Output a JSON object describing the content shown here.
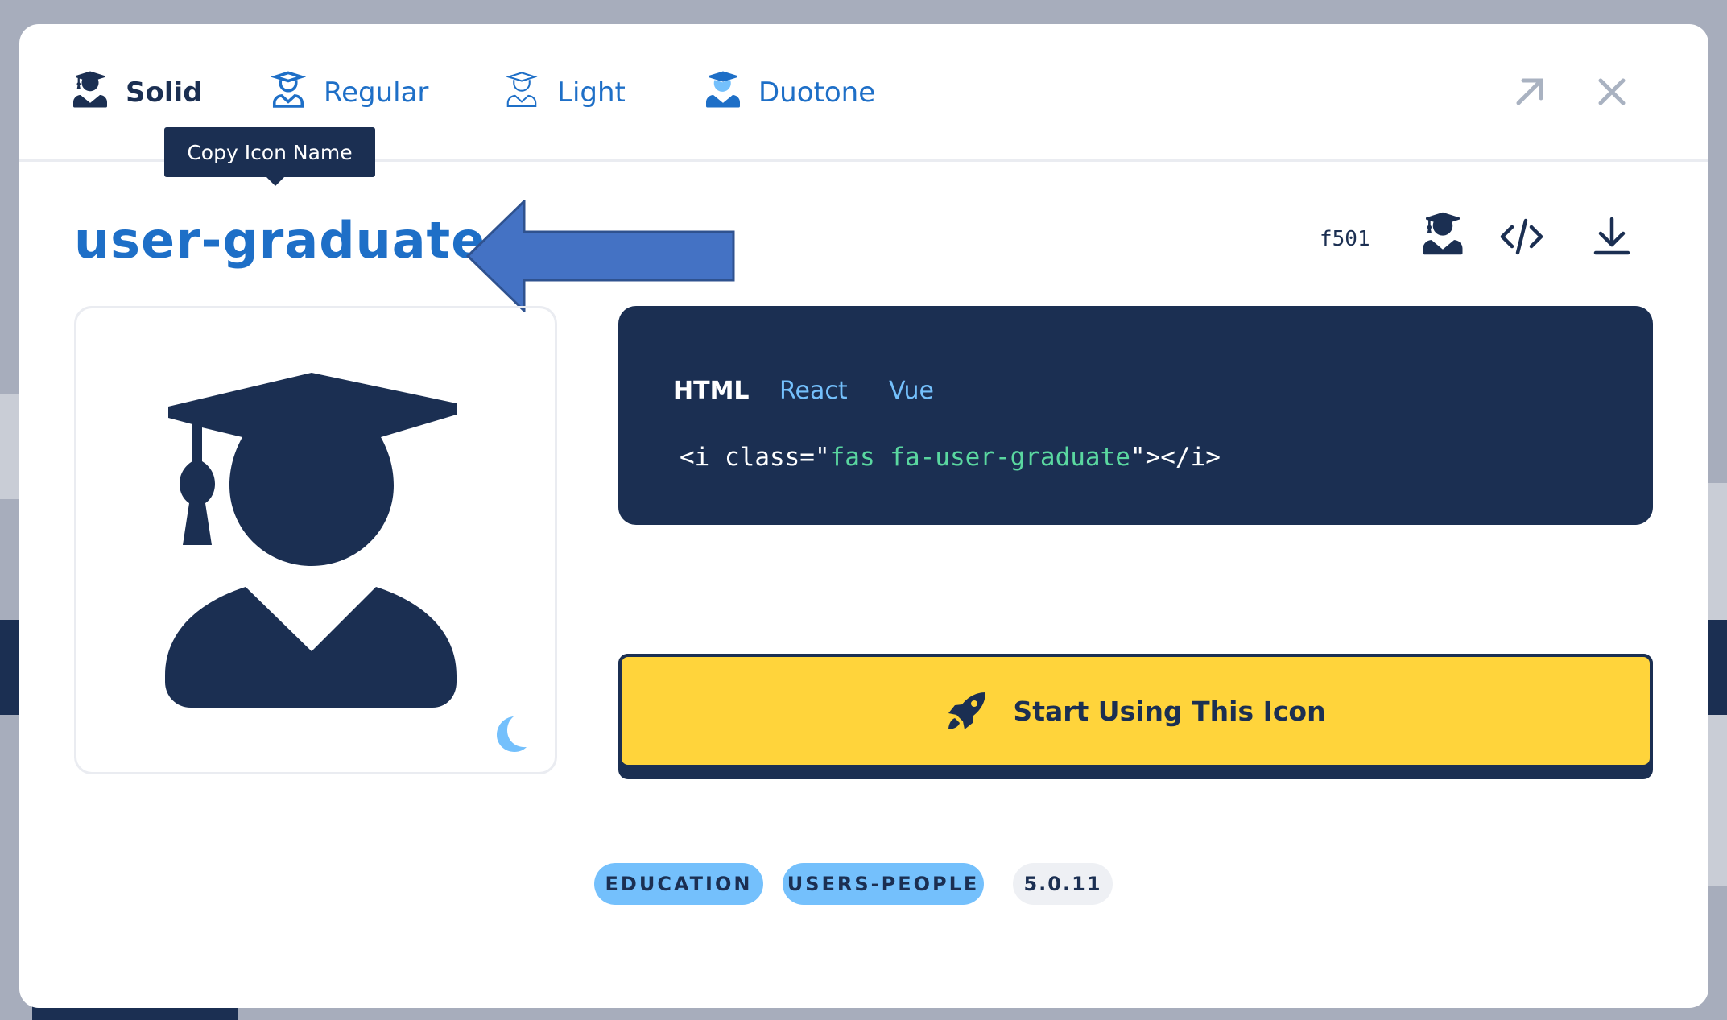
{
  "style_tabs": [
    {
      "label": "Solid",
      "icon": "user-graduate-solid-icon",
      "active": true
    },
    {
      "label": "Regular",
      "icon": "user-graduate-regular-icon"
    },
    {
      "label": "Light",
      "icon": "user-graduate-light-icon"
    },
    {
      "label": "Duotone",
      "icon": "user-graduate-duotone-icon"
    }
  ],
  "header_actions": {
    "open": "arrow-up-right-icon",
    "close": "close-icon"
  },
  "tooltip": "Copy Icon Name",
  "icon_name": "user-graduate",
  "unicode": "f501",
  "code": {
    "tabs": [
      "HTML",
      "React",
      "Vue"
    ],
    "active_tab": "HTML",
    "snippet_open": "<i class=\"",
    "snippet_value": "fas fa-user-graduate",
    "snippet_close": "\"></i>"
  },
  "cta_label": "Start Using This Icon",
  "tags": [
    "EDUCATION",
    "USERS-PEOPLE"
  ],
  "version": "5.0.11",
  "colors": {
    "primary": "#1b2f52",
    "accent": "#1e6fc7",
    "cta": "#ffd43b",
    "tag": "#74c0fc",
    "code_string": "#5ad7a0"
  }
}
